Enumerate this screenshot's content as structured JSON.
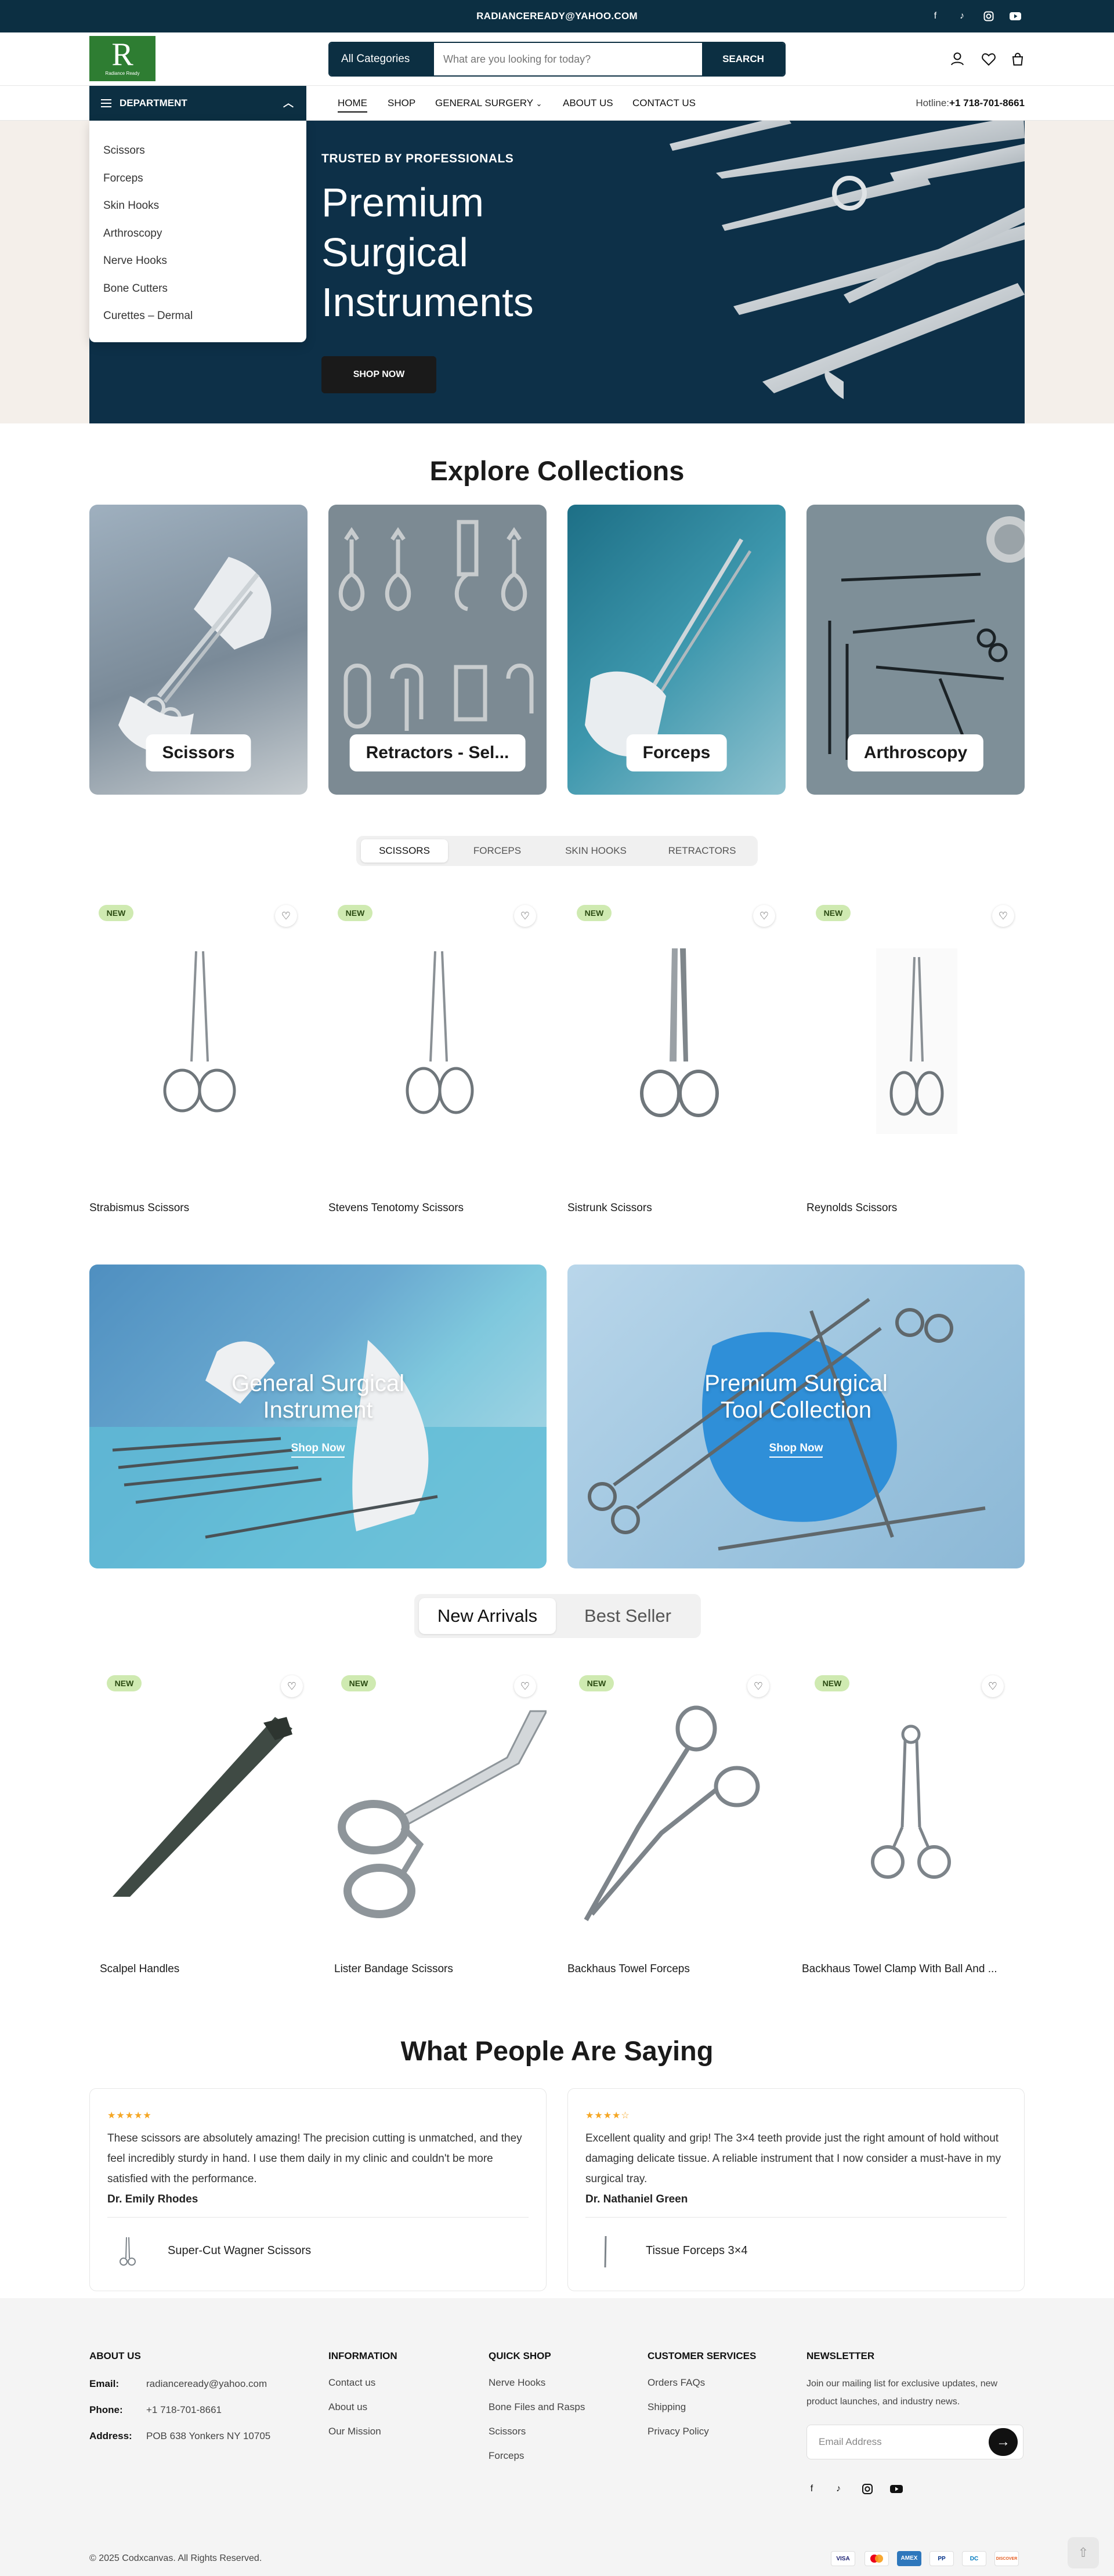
{
  "topbar": {
    "email": "RADIANCEREADY@YAHOO.COM",
    "social": [
      "facebook-icon",
      "tiktok-icon",
      "instagram-icon",
      "youtube-icon"
    ]
  },
  "brand": {
    "logo_letter": "R",
    "logo_sub": "Radiance Ready",
    "color": "#2e7d32"
  },
  "search": {
    "category": "All Categories",
    "placeholder": "What are you looking for today?",
    "button": "SEARCH"
  },
  "department": {
    "label": "DEPARTMENT",
    "items": [
      "Scissors",
      "Forceps",
      "Skin Hooks",
      "Arthroscopy",
      "Nerve Hooks",
      "Bone Cutters",
      "Curettes – Dermal"
    ]
  },
  "nav": {
    "items": [
      "HOME",
      "SHOP",
      "GENERAL SURGERY",
      "ABOUT US",
      "CONTACT US"
    ],
    "hotline_label": "Hotline:",
    "hotline": "+1 718-701-8661"
  },
  "hero": {
    "kicker": "TRUSTED BY PROFESSIONALS",
    "title": "Premium Surgical Instruments",
    "button": "SHOP NOW"
  },
  "collections": {
    "title": "Explore Collections",
    "items": [
      "Scissors",
      "Retractors - Sel...",
      "Forceps",
      "Arthroscopy"
    ]
  },
  "product_tabs": {
    "items": [
      "SCISSORS",
      "FORCEPS",
      "SKIN HOOKS",
      "RETRACTORS"
    ]
  },
  "products1": [
    {
      "badge": "NEW",
      "name": "Strabismus Scissors"
    },
    {
      "badge": "NEW",
      "name": "Stevens Tenotomy Scissors"
    },
    {
      "badge": "NEW",
      "name": "Sistrunk Scissors"
    },
    {
      "badge": "NEW",
      "name": "Reynolds Scissors"
    }
  ],
  "banners": [
    {
      "title": "General Surgical Instrument",
      "link": "Shop Now"
    },
    {
      "title": "Premium Surgical Tool Collection",
      "link": "Shop Now"
    }
  ],
  "arrivals_tabs": {
    "items": [
      "New Arrivals",
      "Best Seller"
    ]
  },
  "products2": [
    {
      "badge": "NEW",
      "name": "Scalpel Handles"
    },
    {
      "badge": "NEW",
      "name": "Lister Bandage Scissors"
    },
    {
      "badge": "NEW",
      "name": "Backhaus Towel Forceps"
    },
    {
      "badge": "NEW",
      "name": "Backhaus Towel Clamp With Ball And ..."
    }
  ],
  "testimonials": {
    "title": "What People Are Saying",
    "items": [
      {
        "stars": "★★★★★",
        "text": "These scissors are absolutely amazing! The precision cutting is unmatched, and they feel incredibly sturdy in hand. I use them daily in my clinic and couldn't be more satisfied with the performance.",
        "author": "Dr. Emily Rhodes",
        "product": "Super-Cut Wagner Scissors"
      },
      {
        "stars": "★★★★☆",
        "text": "Excellent quality and grip! The 3×4 teeth provide just the right amount of hold without damaging delicate tissue. A reliable instrument that I now consider a must-have in my surgical tray.",
        "author": "Dr. Nathaniel Green",
        "product": "Tissue Forceps 3×4"
      }
    ]
  },
  "footer": {
    "about": {
      "title": "ABOUT US",
      "email_label": "Email:",
      "email": "radianceready@yahoo.com",
      "phone_label": "Phone:",
      "phone": "+1 718-701-8661",
      "address_label": "Address:",
      "address": "POB 638 Yonkers NY 10705"
    },
    "information": {
      "title": "INFORMATION",
      "links": [
        "Contact us",
        "About us",
        "Our Mission"
      ]
    },
    "quick_shop": {
      "title": "QUICK SHOP",
      "links": [
        "Nerve Hooks",
        "Bone Files and Rasps",
        "Scissors",
        "Forceps"
      ]
    },
    "customer": {
      "title": "CUSTOMER SERVICES",
      "links": [
        "Orders FAQs",
        "Shipping",
        "Privacy Policy"
      ]
    },
    "newsletter": {
      "title": "NEWSLETTER",
      "text": "Join our mailing list for exclusive updates, new product launches, and industry news.",
      "placeholder": "Email Address"
    },
    "copyright": "© 2025 Codxcanvas. All Rights Reserved.",
    "payments": [
      "VISA",
      "MC",
      "AMEX",
      "PP",
      "DC",
      "DISCOVER"
    ]
  },
  "colors": {
    "navy": "#0c2f42",
    "badge": "#cfeab1",
    "star": "#f5a623"
  }
}
